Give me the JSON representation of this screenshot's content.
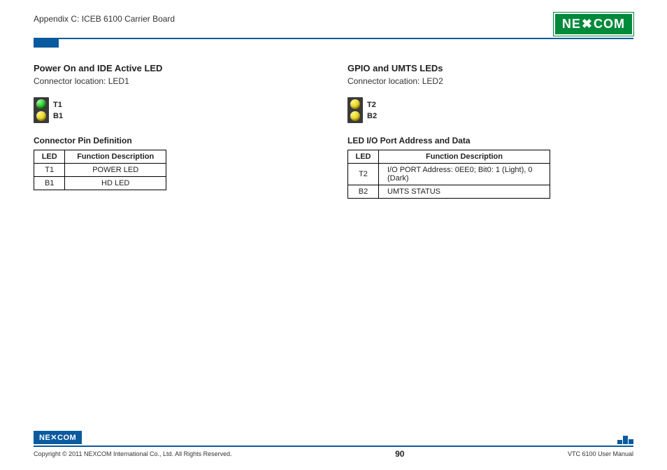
{
  "header": {
    "appendix": "Appendix C: ICEB 6100 Carrier Board",
    "logo_text": "NE COM",
    "logo_x": "✕"
  },
  "left": {
    "title": "Power On and IDE Active LED",
    "subtitle": "Connector location: LED1",
    "led": {
      "top_color": "green",
      "bottom_color": "yellow",
      "top_label": "T1",
      "bottom_label": "B1"
    },
    "subhead": "Connector Pin Definition",
    "table": {
      "headers": [
        "LED",
        "Function Description"
      ],
      "rows": [
        [
          "T1",
          "POWER LED"
        ],
        [
          "B1",
          "HD LED"
        ]
      ]
    }
  },
  "right": {
    "title": "GPIO and UMTS LEDs",
    "subtitle": "Connector location: LED2",
    "led": {
      "top_color": "yellow",
      "bottom_color": "yellow",
      "top_label": "T2",
      "bottom_label": "B2"
    },
    "subhead": "LED I/O Port Address and Data",
    "table": {
      "headers": [
        "LED",
        "Function Description"
      ],
      "rows": [
        [
          "T2",
          "I/O PORT Address: 0EE0; Bit0: 1 (Light), 0 (Dark)"
        ],
        [
          "B2",
          "UMTS STATUS"
        ]
      ]
    }
  },
  "footer": {
    "logo_text": "NE✕COM",
    "copyright": "Copyright © 2011 NEXCOM International Co., Ltd. All Rights Reserved.",
    "page": "90",
    "doc": "VTC 6100 User Manual"
  }
}
